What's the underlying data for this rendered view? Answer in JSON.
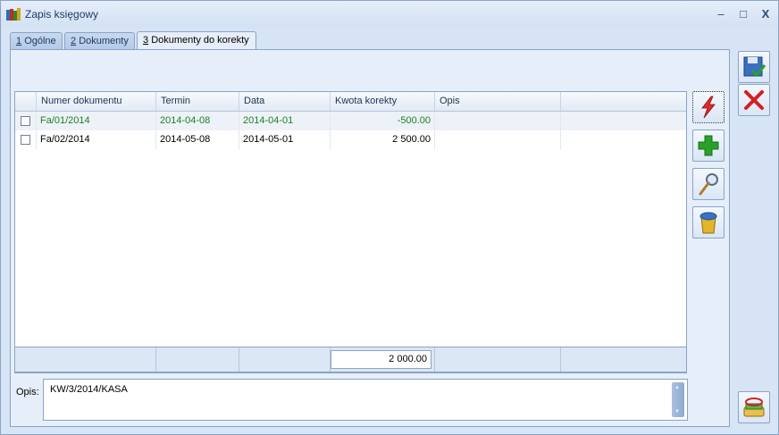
{
  "window": {
    "title": "Zapis księgowy",
    "controls": {
      "minimize": "–",
      "maximize": "□",
      "close": "X"
    }
  },
  "tabs": [
    {
      "key": "1",
      "label": "Ogólne",
      "active": false
    },
    {
      "key": "2",
      "label": "Dokumenty",
      "active": false
    },
    {
      "key": "3",
      "label": "Dokumenty do korekty",
      "active": true
    }
  ],
  "grid": {
    "columns": [
      "Numer dokumentu",
      "Termin",
      "Data",
      "Kwota korekty",
      "Opis"
    ],
    "rows": [
      {
        "numer": "Fa/01/2014",
        "termin": "2014-04-08",
        "data": "2014-04-01",
        "kwota": "-500.00",
        "opis": "",
        "checked": false
      },
      {
        "numer": "Fa/02/2014",
        "termin": "2014-05-08",
        "data": "2014-05-01",
        "kwota": "2 500.00",
        "opis": "",
        "checked": false
      }
    ],
    "total": "2 000.00"
  },
  "opis": {
    "label": "Opis:",
    "value": "KW/3/2014/KASA"
  },
  "toolbar": {
    "icons": [
      "lightning-icon",
      "plus-icon",
      "magnifier-icon",
      "trash-icon"
    ]
  },
  "side": {
    "icons": [
      "save-icon",
      "cancel-icon",
      "accounting-icon"
    ]
  },
  "colors": {
    "green_text": "#1d7f24",
    "cancel_red": "#d42020",
    "plus_green": "#2aa02a"
  }
}
